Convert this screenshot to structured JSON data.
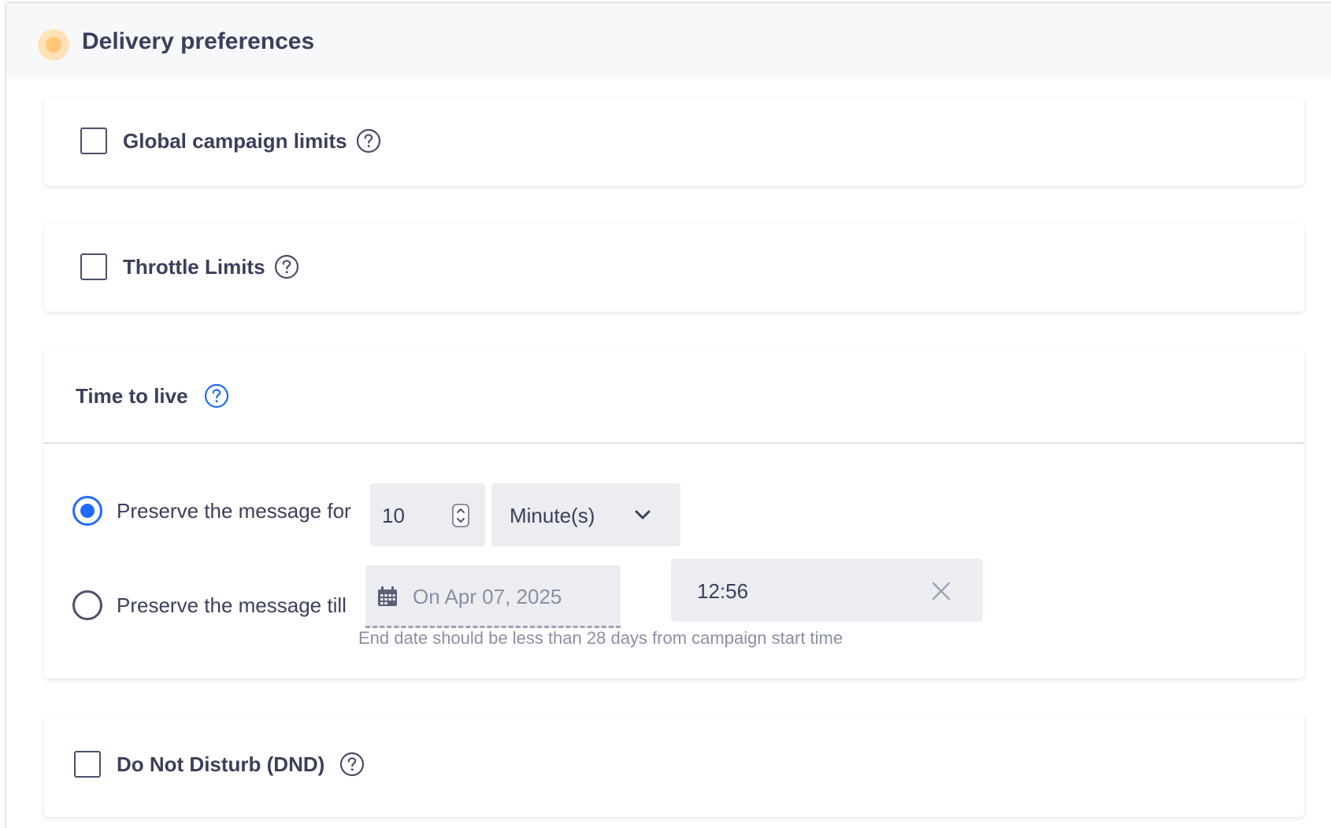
{
  "panel": {
    "title": "Delivery preferences"
  },
  "sections": {
    "global_campaign_limits": {
      "label": "Global campaign limits",
      "checked": false
    },
    "throttle_limits": {
      "label": "Throttle Limits",
      "checked": false
    },
    "time_to_live": {
      "label": "Time to live",
      "options": {
        "preserve_for": {
          "label": "Preserve the message for",
          "selected": true,
          "amount": "10",
          "unit": "Minute(s)"
        },
        "preserve_till": {
          "label": "Preserve the message till",
          "selected": false,
          "date": "On Apr 07, 2025",
          "time": "12:56",
          "hint": "End date should be less than 28 days from campaign start time"
        }
      }
    },
    "do_not_disturb": {
      "label": "Do Not Disturb (DND)",
      "checked": false
    }
  },
  "colors": {
    "accent": "#1f6bff",
    "status_dot": "#ffc57a",
    "text": "#3b3f5c",
    "muted": "#8a8fa3",
    "field_bg": "#ebedf1"
  },
  "icons": {
    "status": "status-dot-icon",
    "help": "question-circle-icon",
    "stepper": "up-down-stepper-icon",
    "dropdown": "chevron-down-icon",
    "calendar": "calendar-icon",
    "clear": "close-icon"
  }
}
